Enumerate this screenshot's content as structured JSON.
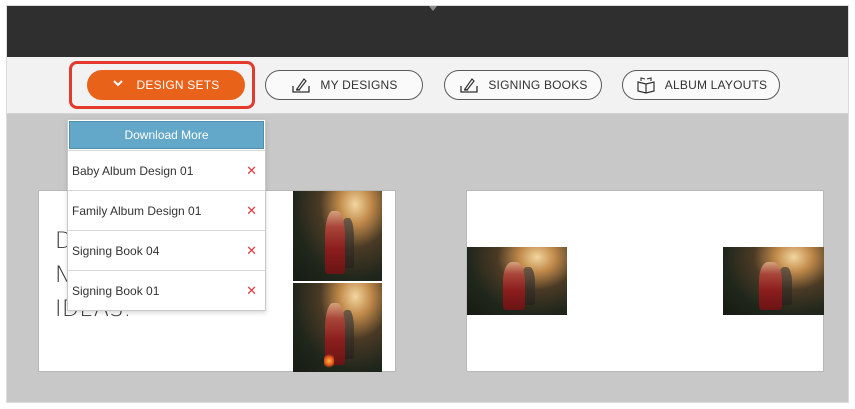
{
  "toolbar": {
    "design_sets_label": "DESIGN SETS",
    "my_designs_label": "MY DESIGNS",
    "signing_books_label": "SIGNING BOOKS",
    "album_layouts_label": "ALBUM LAYOUTS",
    "active_color": "#e8621a",
    "highlight_color": "#e23a2c"
  },
  "icons": {
    "design_sets": "chevron-down-icon",
    "my_designs": "pen-tray-icon",
    "signing_books": "pen-tray-icon",
    "album_layouts": "open-album-icon"
  },
  "dropdown": {
    "download_label": "Download More",
    "items": [
      {
        "label": "Baby Album Design 01",
        "delete": "✕"
      },
      {
        "label": "Family Album Design 01",
        "delete": "✕"
      },
      {
        "label": "Signing Book 04",
        "delete": "✕"
      },
      {
        "label": "Signing Book 01",
        "delete": "✕"
      }
    ]
  },
  "preview": {
    "headline": [
      "D",
      "N",
      "IDEAS."
    ]
  },
  "colors": {
    "download_bg": "#63a8c8",
    "delete_color": "#e0393e",
    "topbar": "#2f2f2f"
  }
}
